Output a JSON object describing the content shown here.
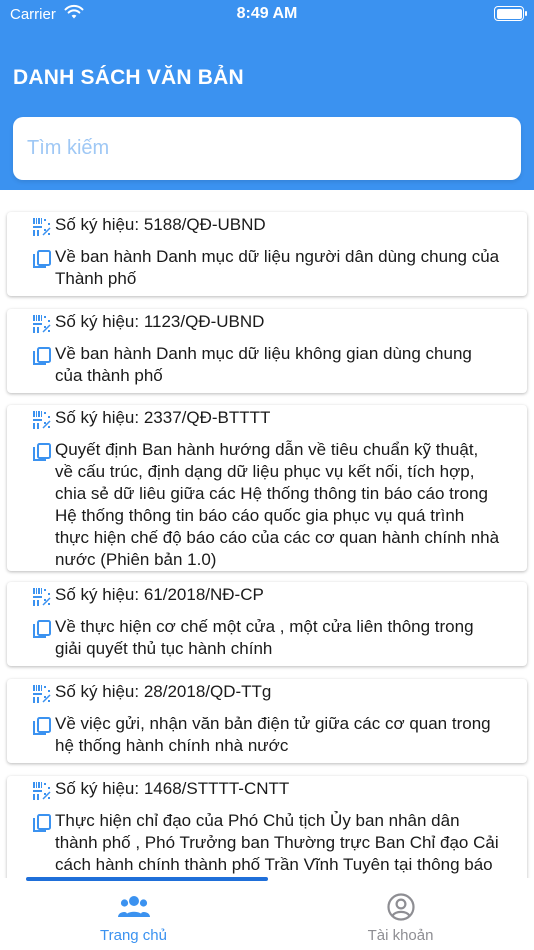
{
  "status_bar": {
    "carrier": "Carrier",
    "time": "8:49 AM"
  },
  "header": {
    "title": "DANH SÁCH VĂN BẢN"
  },
  "search": {
    "placeholder": "Tìm kiếm"
  },
  "documents": [
    {
      "number": "Số ký hiệu: 5188/QĐ-UBND",
      "summary_lines": [
        "Về ban hành Danh mục dữ liệu người dân dùng chung của",
        "Thành phố"
      ]
    },
    {
      "number": "Số ký hiệu: 1123/QĐ-UBND",
      "summary_lines": [
        "Về ban hành Danh mục dữ liệu không gian dùng chung",
        "của thành phố"
      ]
    },
    {
      "number": "Số ký hiệu: 2337/QĐ-BTTTT",
      "summary_lines": [
        "Quyết định Ban hành hướng dẫn về tiêu chuẩn kỹ thuật,",
        "về cấu trúc, định dạng dữ liệu phục vụ kết nối, tích hợp,",
        "chia sẻ dữ liêu giữa các Hệ thống thông tin báo cáo trong",
        "Hệ thống thông tin báo cáo quốc gia phục vụ quá trình",
        "thực hiện chế độ báo cáo của các cơ quan hành chính nhà",
        "nước (Phiên bản 1.0)"
      ]
    },
    {
      "number": "Số ký hiệu: 61/2018/NĐ-CP",
      "summary_lines": [
        "Về thực hiện cơ chế một cửa , một cửa liên thông trong",
        "giải quyết thủ tục hành chính"
      ]
    },
    {
      "number": "Số ký hiệu: 28/2018/QD-TTg",
      "summary_lines": [
        "Về việc gửi, nhận văn bản điện tử giữa các cơ quan trong",
        "hệ thống hành chính nhà nước"
      ]
    },
    {
      "number": "Số ký hiệu: 1468/STTTT-CNTT",
      "summary_lines": [
        "Thực hiện chỉ đạo của Phó Chủ tịch Ủy ban nhân dân",
        "thành phố , Phó Trưởng ban Thường trực Ban Chỉ đạo Cải",
        "cách hành chính thành phố Trần Vĩnh Tuyên tại thông báo"
      ]
    }
  ],
  "tabs": [
    {
      "label": "Trang chủ",
      "icon": "users-icon",
      "active": true
    },
    {
      "label": "Tài khoản",
      "icon": "account-icon",
      "active": false
    }
  ],
  "colors": {
    "primary": "#3b92f0",
    "inactive": "#8e8e93",
    "scroll_indicator": "#1f6fd9"
  }
}
